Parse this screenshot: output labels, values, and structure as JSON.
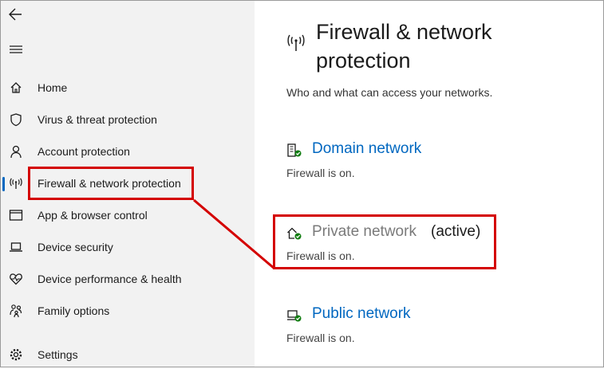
{
  "sidebar": {
    "items": [
      {
        "label": "Home",
        "icon": "home-icon"
      },
      {
        "label": "Virus & threat protection",
        "icon": "shield-icon"
      },
      {
        "label": "Account protection",
        "icon": "person-icon"
      },
      {
        "label": "Firewall & network protection",
        "icon": "wireless-antenna-icon",
        "active": true
      },
      {
        "label": "App & browser control",
        "icon": "app-window-icon"
      },
      {
        "label": "Device security",
        "icon": "laptop-icon"
      },
      {
        "label": "Device performance & health",
        "icon": "heart-pulse-icon"
      },
      {
        "label": "Family options",
        "icon": "family-icon"
      },
      {
        "label": "Settings",
        "icon": "gear-icon"
      }
    ]
  },
  "main": {
    "title": "Firewall & network protection",
    "subtitle": "Who and what can access your networks.",
    "networks": [
      {
        "name": "Domain network",
        "status": "Firewall is on.",
        "icon": "domain-network-icon"
      },
      {
        "name": "Private network",
        "active_label": "(active)",
        "status": "Firewall is on.",
        "icon": "private-network-icon"
      },
      {
        "name": "Public network",
        "status": "Firewall is on.",
        "icon": "public-network-icon"
      }
    ]
  },
  "colors": {
    "accent": "#0067c0",
    "highlight": "#d40000",
    "check": "#107c10",
    "sidebar_bg": "#f2f2f2"
  }
}
